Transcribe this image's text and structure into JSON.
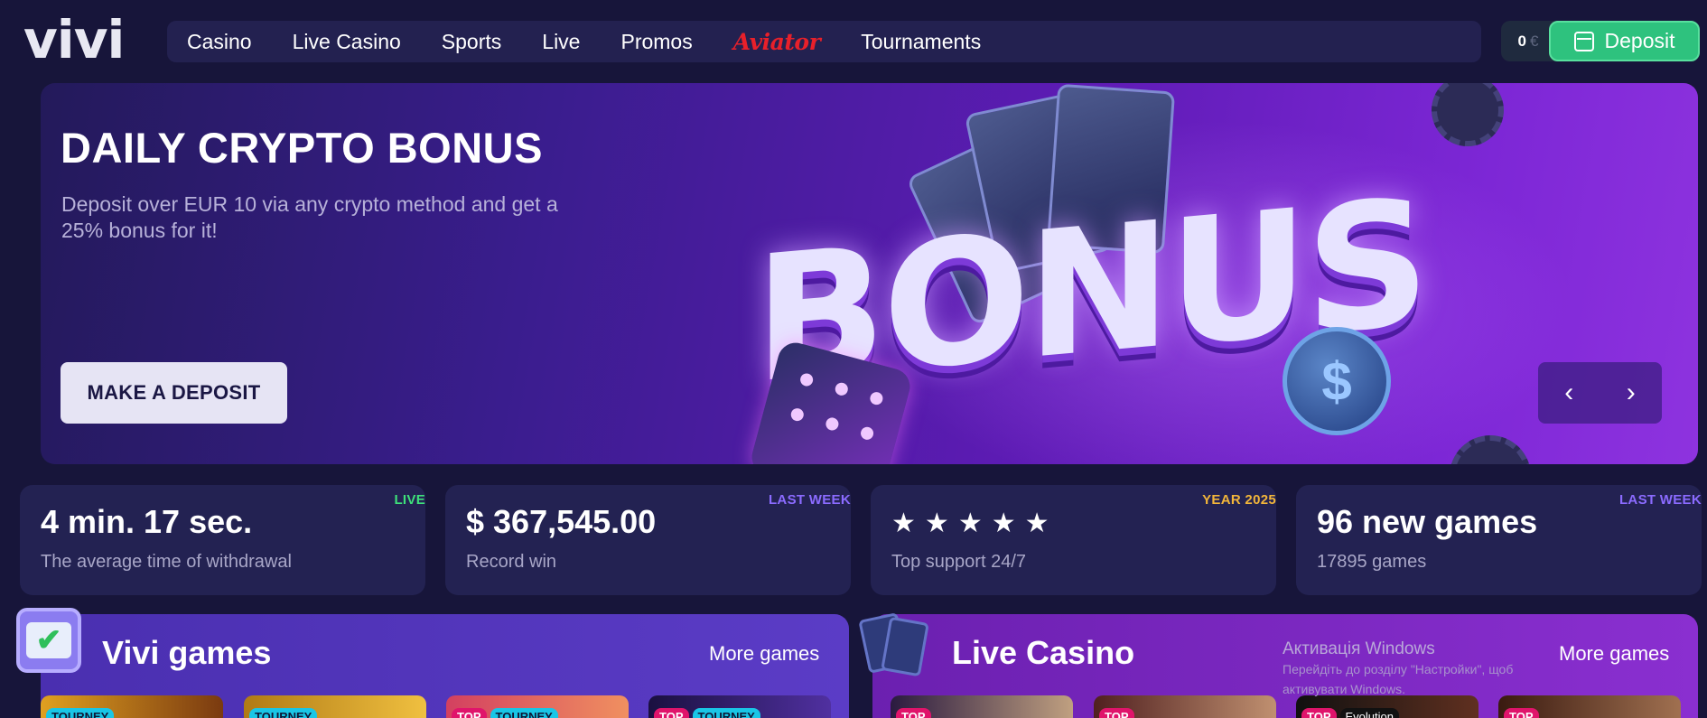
{
  "header": {
    "logo": "vivi",
    "nav": [
      {
        "label": "Casino"
      },
      {
        "label": "Live Casino"
      },
      {
        "label": "Sports"
      },
      {
        "label": "Live"
      },
      {
        "label": "Promos"
      },
      {
        "label": "Aviator"
      },
      {
        "label": "Tournaments"
      }
    ],
    "balance": {
      "amount": "0",
      "currency": "€"
    },
    "deposit_label": "Deposit"
  },
  "hero": {
    "title": "DAILY CRYPTO BONUS",
    "subtitle": "Deposit over EUR 10 via any crypto method and get a 25% bonus for it!",
    "cta_label": "MAKE A DEPOSIT",
    "art_word": "BONUS",
    "coin_symbol": "$",
    "prev_icon": "‹",
    "next_icon": "›"
  },
  "stats": [
    {
      "tag": "LIVE",
      "tag_color": "#3ee07a",
      "value": "4 min. 17 sec.",
      "label": "The average time of withdrawal"
    },
    {
      "tag": "LAST WEEK",
      "tag_color": "#8b6bff",
      "value": "$ 367,545.00",
      "label": "Record win"
    },
    {
      "tag": "YEAR 2025",
      "tag_color": "#f2b53a",
      "rating": 5,
      "label": "Top support 24/7"
    },
    {
      "tag": "LAST WEEK",
      "tag_color": "#8b6bff",
      "value": "96 new games",
      "label": "17895 games"
    }
  ],
  "sections": {
    "vivi_games": {
      "title": "Vivi games",
      "more": "More games",
      "badges": [
        [
          "TOURNEY"
        ],
        [
          "TOURNEY"
        ],
        [
          "TOP",
          "TOURNEY"
        ],
        [
          "TOP",
          "TOURNEY"
        ]
      ]
    },
    "live_casino": {
      "title": "Live Casino",
      "more": "More games",
      "badges": [
        [
          "TOP"
        ],
        [
          "TOP"
        ],
        [
          "TOP",
          "Evolution"
        ],
        [
          "TOP"
        ]
      ]
    }
  },
  "windows_notice": {
    "title": "Активація Windows",
    "body": "Перейдіть до розділу \"Настройки\", щоб активувати Windows."
  },
  "colors": {
    "accent_green": "#2ec27e",
    "background": "#17153a",
    "card_bg": "#232252"
  }
}
